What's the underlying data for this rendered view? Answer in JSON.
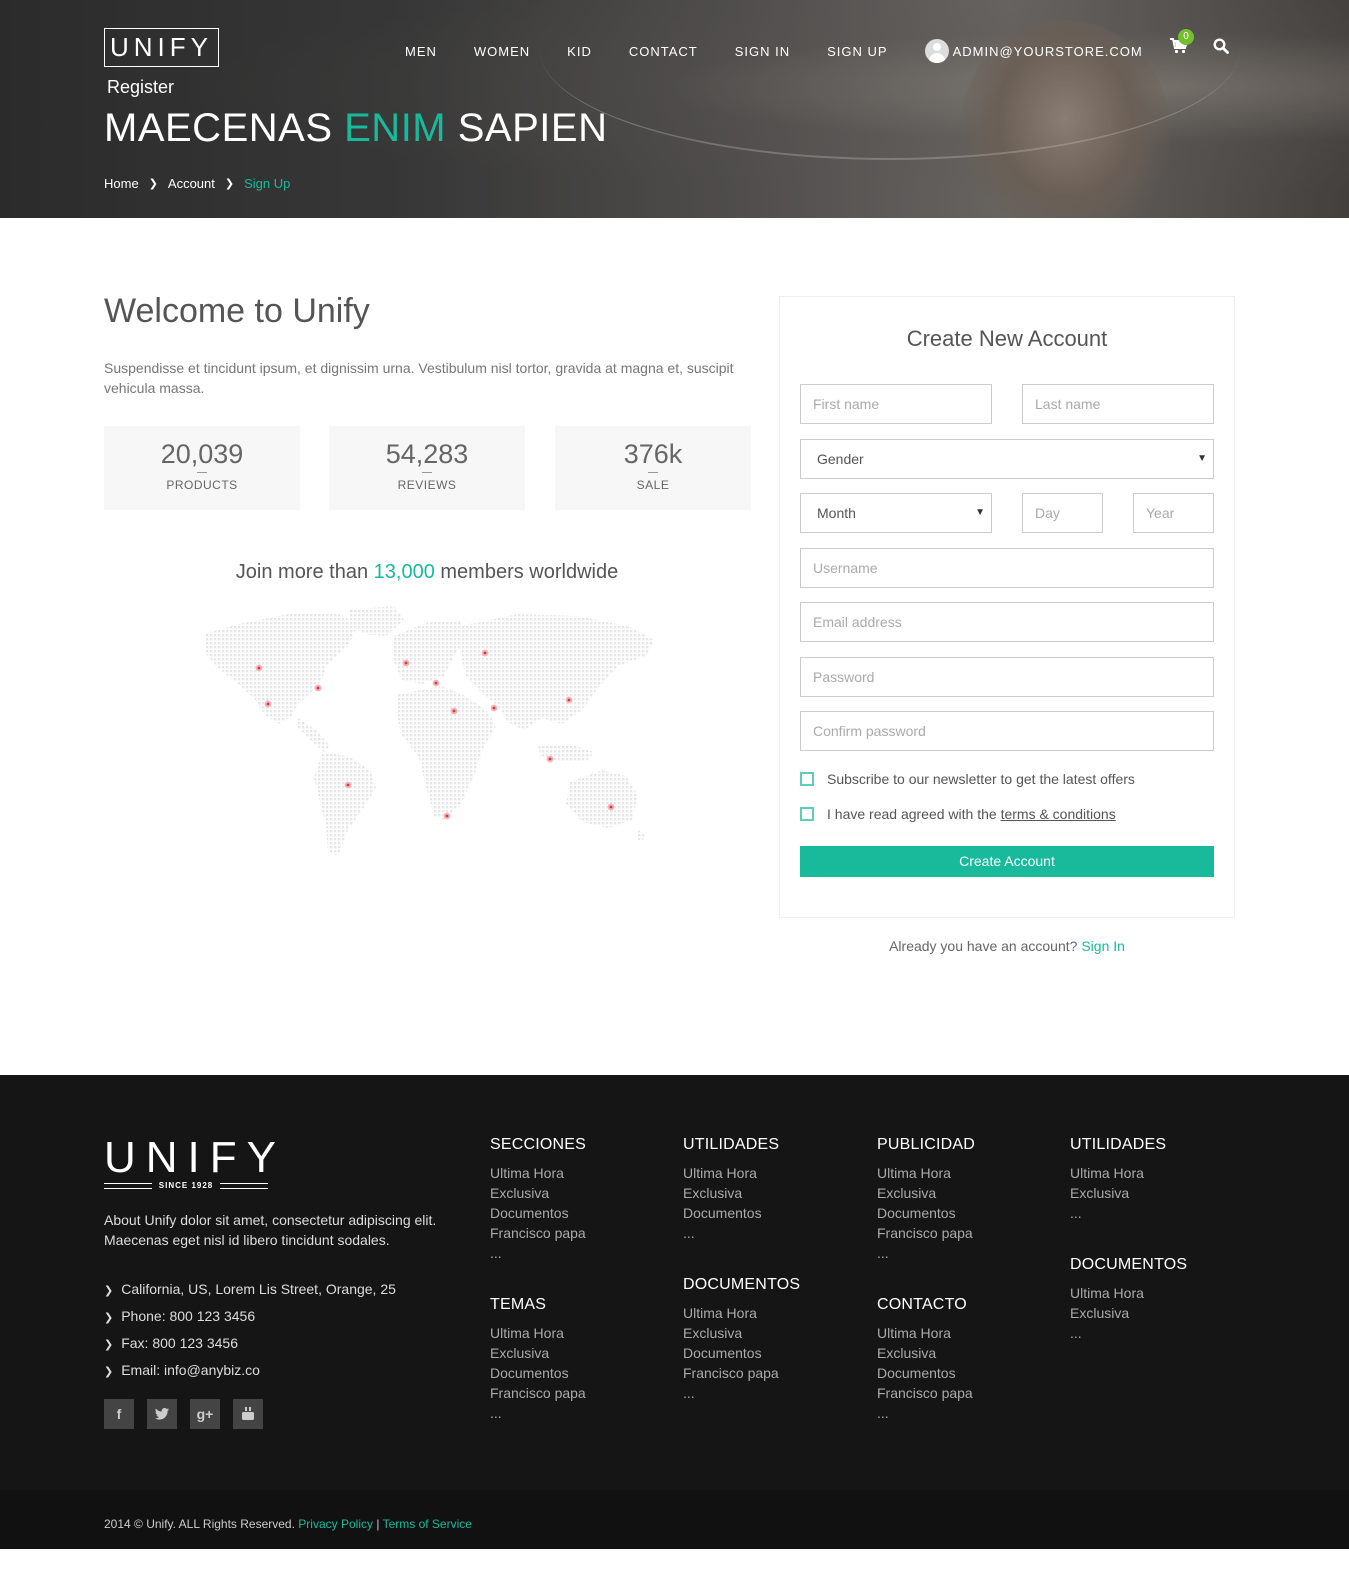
{
  "header": {
    "logo": "UNIFY",
    "nav": [
      "MEN",
      "WOMEN",
      "KID",
      "CONTACT",
      "SIGN IN",
      "SIGN UP"
    ],
    "user_email": "ADMIN@YOURSTORE.COM",
    "cart_count": "0",
    "subtitle": "Register",
    "title_part1": "MAECENAS",
    "title_accent": "ENIM",
    "title_part2": "SAPIEN",
    "breadcrumb": [
      "Home",
      "Account",
      "Sign Up"
    ],
    "accent_color": "#18ba9b"
  },
  "main": {
    "welcome": "Welcome to Unify",
    "intro": "Suspendisse et tincidunt ipsum, et dignissim urna. Vestibulum nisl tortor, gravida at magna et, suscipit vehicula massa.",
    "stats": [
      {
        "value": "20,039",
        "label": "PRODUCTS"
      },
      {
        "value": "54,283",
        "label": "REVIEWS"
      },
      {
        "value": "376k",
        "label": "SALE"
      }
    ],
    "join_pre": "Join more than",
    "join_count": "13,000",
    "join_post": "members worldwide"
  },
  "form": {
    "title": "Create New Account",
    "first_name_placeholder": "First name",
    "last_name_placeholder": "Last name",
    "gender": "Gender",
    "month": "Month",
    "day_placeholder": "Day",
    "year_placeholder": "Year",
    "username_placeholder": "Username",
    "email_placeholder": "Email address",
    "password_placeholder": "Password",
    "confirm_placeholder": "Confirm password",
    "newsletter": "Subscribe to our newsletter to get the latest offers",
    "terms_pre": "I have read agreed with the",
    "terms_link": "terms & conditions",
    "submit": "Create Account",
    "already": "Already you have an account?",
    "sign_in": "Sign In"
  },
  "footer": {
    "logo": "UNIFY",
    "since": "SINCE 1928",
    "about": "About Unify dolor sit amet, consectetur adipiscing elit. Maecenas eget nisl id libero tincidunt sodales.",
    "contact": [
      "California, US, Lorem Lis Street, Orange, 25",
      "Phone: 800 123 3456",
      "Fax: 800 123 3456",
      "Email: info@anybiz.co"
    ],
    "social": [
      "facebook-icon",
      "twitter-icon",
      "google-plus-icon",
      "youtube-icon"
    ],
    "columns": [
      {
        "title": "SECCIONES",
        "items": [
          "Ultima Hora",
          "Exclusiva",
          "Documentos",
          "Francisco papa",
          "..."
        ]
      },
      {
        "title": "TEMAS",
        "items": [
          "Ultima Hora",
          "Exclusiva",
          "Documentos",
          "Francisco papa",
          "..."
        ]
      },
      {
        "title": "UTILIDADES",
        "items": [
          "Ultima Hora",
          "Exclusiva",
          "Documentos",
          "..."
        ]
      },
      {
        "title": "DOCUMENTOS",
        "items": [
          "Ultima Hora",
          "Exclusiva",
          "Documentos",
          "Francisco papa",
          "..."
        ]
      },
      {
        "title": "PUBLICIDAD",
        "items": [
          "Ultima Hora",
          "Exclusiva",
          "Documentos",
          "Francisco papa",
          "..."
        ]
      },
      {
        "title": "CONTACTO",
        "items": [
          "Ultima Hora",
          "Exclusiva",
          "Documentos",
          "Francisco papa",
          "..."
        ]
      },
      {
        "title": "UTILIDADES",
        "items": [
          "Ultima Hora",
          "Exclusiva",
          "..."
        ]
      },
      {
        "title": "DOCUMENTOS",
        "items": [
          "Ultima Hora",
          "Exclusiva",
          "..."
        ]
      }
    ],
    "copyright": "2014 © Unify. ALL Rights Reserved.",
    "privacy": "Privacy Policy",
    "separator": "|",
    "terms": "Terms of Service"
  }
}
